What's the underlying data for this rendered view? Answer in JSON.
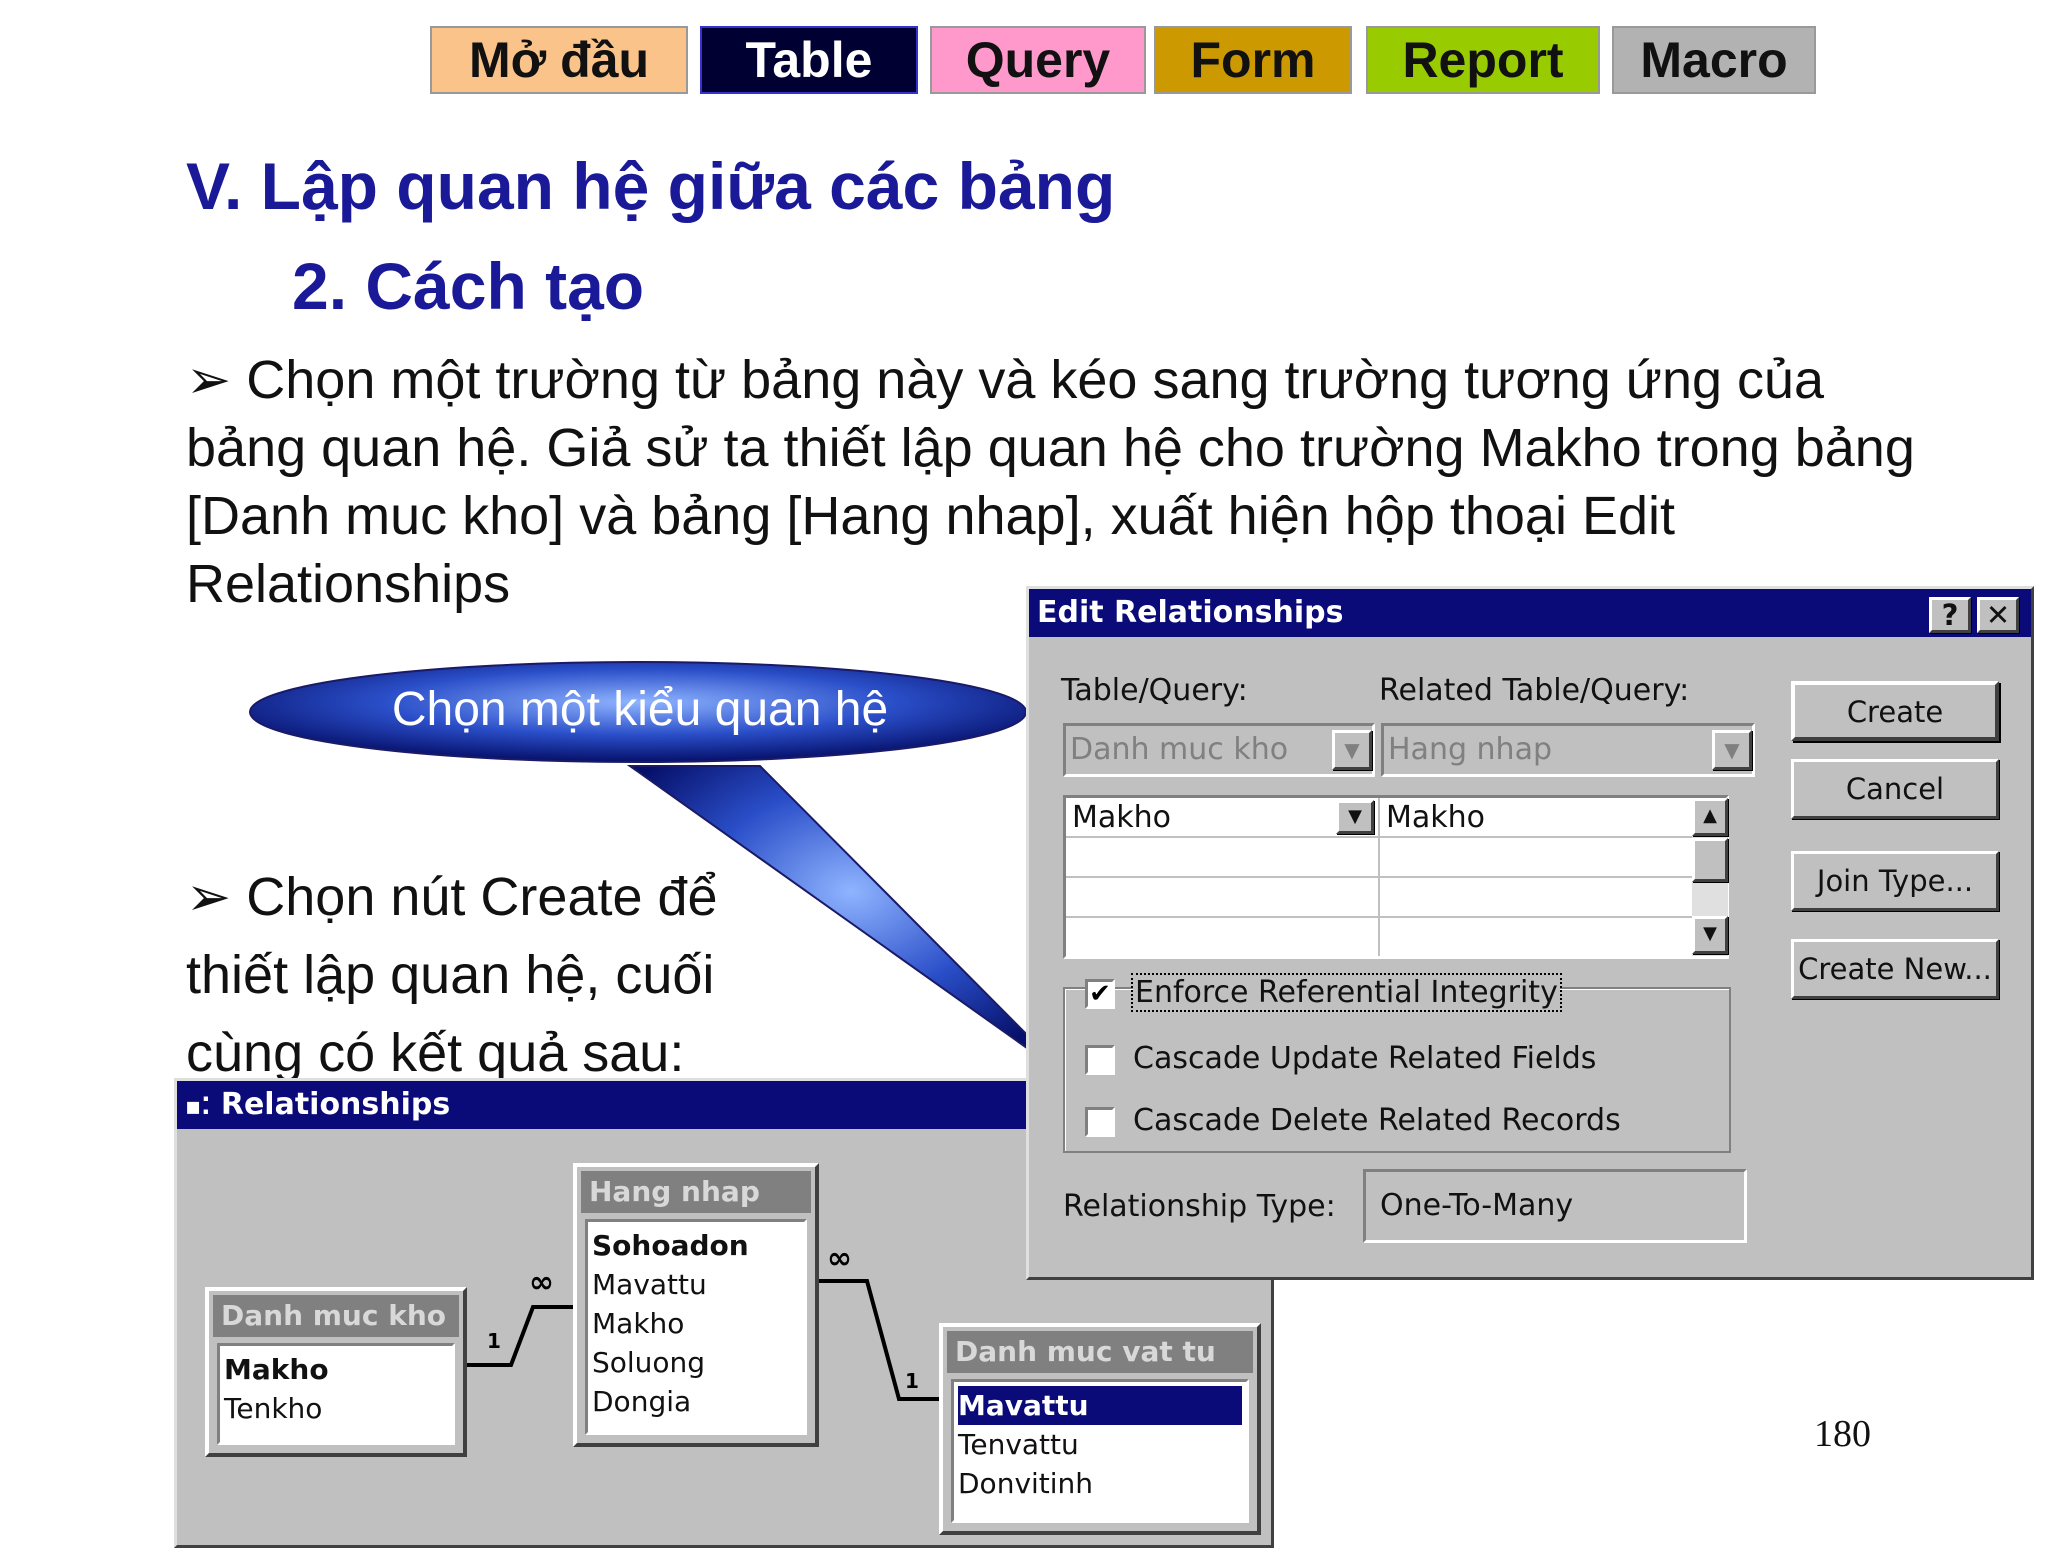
{
  "nav": {
    "tabs": [
      {
        "label": "Mở đầu",
        "color": "#f9c38a"
      },
      {
        "label": "Table",
        "color": "#000033"
      },
      {
        "label": "Query",
        "color": "#ff99cc"
      },
      {
        "label": "Form",
        "color": "#cc9900"
      },
      {
        "label": "Report",
        "color": "#99cc00"
      },
      {
        "label": "Macro",
        "color": "#b2b2b2"
      }
    ]
  },
  "slide": {
    "heading": "V. Lập quan hệ giữa các bảng",
    "subheading": "2. Cách tạo",
    "bullet1_lines": [
      "Chọn một trường từ bảng này và kéo sang trường tương ứng của",
      "bảng quan hệ. Giả sử ta thiết lập quan hệ cho trường Makho trong bảng",
      "[Danh muc kho] và bảng [Hang nhap], xuất hiện hộp thoại Edit",
      "Relationships"
    ],
    "bullet2_lines": [
      "Chọn nút Create để",
      "thiết lập quan hệ, cuối",
      "cùng có kết quả sau:"
    ],
    "callout": "Chọn một kiểu quan hệ",
    "page_number": "180"
  },
  "edit_dialog": {
    "title": "Edit Relationships",
    "help": "?",
    "close": "✕",
    "table_label": "Table/Query:",
    "related_label": "Related Table/Query:",
    "table_value": "Danh muc kho",
    "related_value": "Hang nhap",
    "grid_left": "Makho",
    "grid_right": "Makho",
    "enforce": "Enforce Referential Integrity",
    "cascade_update": "Cascade Update Related Fields",
    "cascade_delete": "Cascade Delete Related Records",
    "type_label": "Relationship Type:",
    "type_value": "One-To-Many",
    "buttons": {
      "create": "Create",
      "cancel": "Cancel",
      "join": "Join Type...",
      "create_new": "Create New..."
    }
  },
  "rel_window": {
    "title": "Relationships",
    "tables": [
      {
        "name": "Danh muc kho",
        "fields": [
          "Makho",
          "Tenkho"
        ]
      },
      {
        "name": "Hang nhap",
        "fields": [
          "Sohoadon",
          "Mavattu",
          "Makho",
          "Soluong",
          "Dongia"
        ]
      },
      {
        "name": "Danh muc vat tu",
        "fields": [
          "Mavattu",
          "Tenvattu",
          "Donvitinh"
        ]
      }
    ],
    "one": "1",
    "many": "∞"
  }
}
